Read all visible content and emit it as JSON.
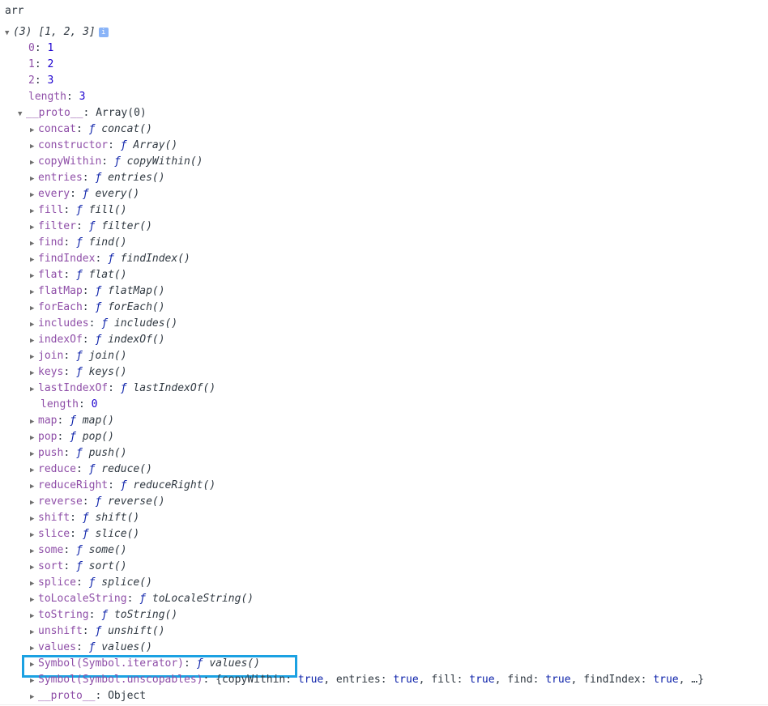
{
  "command": "arr",
  "summary": {
    "count": "(3)",
    "preview": "[1, 2, 3]"
  },
  "elements": [
    {
      "key": "0",
      "value": "1"
    },
    {
      "key": "1",
      "value": "2"
    },
    {
      "key": "2",
      "value": "3"
    },
    {
      "key": "length",
      "value": "3"
    }
  ],
  "proto": {
    "key": "__proto__",
    "value": "Array(0)"
  },
  "fn_symbol": "ƒ",
  "methods": [
    {
      "key": "concat",
      "fn": "concat()"
    },
    {
      "key": "constructor",
      "fn": "Array()"
    },
    {
      "key": "copyWithin",
      "fn": "copyWithin()"
    },
    {
      "key": "entries",
      "fn": "entries()"
    },
    {
      "key": "every",
      "fn": "every()"
    },
    {
      "key": "fill",
      "fn": "fill()"
    },
    {
      "key": "filter",
      "fn": "filter()"
    },
    {
      "key": "find",
      "fn": "find()"
    },
    {
      "key": "findIndex",
      "fn": "findIndex()"
    },
    {
      "key": "flat",
      "fn": "flat()"
    },
    {
      "key": "flatMap",
      "fn": "flatMap()"
    },
    {
      "key": "forEach",
      "fn": "forEach()"
    },
    {
      "key": "includes",
      "fn": "includes()"
    },
    {
      "key": "indexOf",
      "fn": "indexOf()"
    },
    {
      "key": "join",
      "fn": "join()"
    },
    {
      "key": "keys",
      "fn": "keys()"
    },
    {
      "key": "lastIndexOf",
      "fn": "lastIndexOf()"
    },
    {
      "key": "length",
      "value": "0"
    },
    {
      "key": "map",
      "fn": "map()"
    },
    {
      "key": "pop",
      "fn": "pop()"
    },
    {
      "key": "push",
      "fn": "push()"
    },
    {
      "key": "reduce",
      "fn": "reduce()"
    },
    {
      "key": "reduceRight",
      "fn": "reduceRight()"
    },
    {
      "key": "reverse",
      "fn": "reverse()"
    },
    {
      "key": "shift",
      "fn": "shift()"
    },
    {
      "key": "slice",
      "fn": "slice()"
    },
    {
      "key": "some",
      "fn": "some()"
    },
    {
      "key": "sort",
      "fn": "sort()"
    },
    {
      "key": "splice",
      "fn": "splice()"
    },
    {
      "key": "toLocaleString",
      "fn": "toLocaleString()"
    },
    {
      "key": "toString",
      "fn": "toString()"
    },
    {
      "key": "unshift",
      "fn": "unshift()"
    },
    {
      "key": "values",
      "fn": "values()"
    },
    {
      "key": "Symbol(Symbol.iterator)",
      "fn": "values()"
    }
  ],
  "unscopables": {
    "key": "Symbol(Symbol.unscopables)",
    "open": "{",
    "entries": [
      {
        "k": "copyWithin",
        "v": "true"
      },
      {
        "k": "entries",
        "v": "true"
      },
      {
        "k": "fill",
        "v": "true"
      },
      {
        "k": "find",
        "v": "true"
      },
      {
        "k": "findIndex",
        "v": "true"
      }
    ],
    "tail": "…}"
  },
  "proto2": {
    "key": "__proto__",
    "value": "Object"
  },
  "highlight_color": "#1ba1e2"
}
